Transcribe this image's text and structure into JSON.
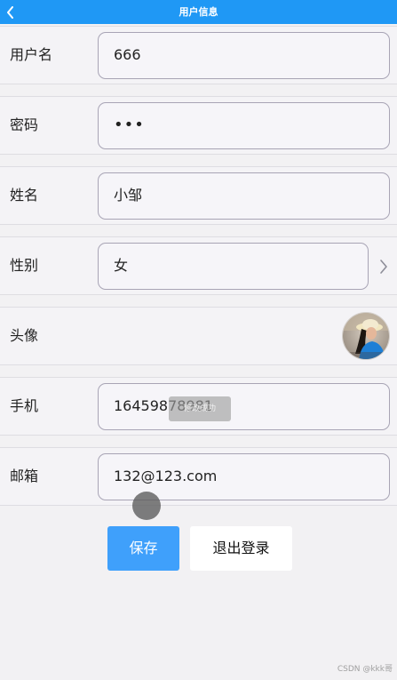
{
  "header": {
    "title": "用户信息",
    "background_color": "#1f98f5",
    "back_icon": "chevron-left-icon"
  },
  "form": {
    "username": {
      "label": "用户名",
      "value": "666"
    },
    "password": {
      "label": "密码",
      "value": "•••"
    },
    "name": {
      "label": "姓名",
      "value": "小邹"
    },
    "gender": {
      "label": "性别",
      "value": "女",
      "icon": "chevron-right-icon"
    },
    "avatar": {
      "label": "头像",
      "icon": "avatar-photo"
    },
    "phone": {
      "label": "手机",
      "value": "16459878981"
    },
    "email": {
      "label": "邮箱",
      "value": "132@123.com"
    }
  },
  "overlay": {
    "toast_text": "修改成功"
  },
  "buttons": {
    "save_label": "保存",
    "save_color": "#3fa0fb",
    "logout_label": "退出登录"
  },
  "watermark": "CSDN @kkk哥"
}
